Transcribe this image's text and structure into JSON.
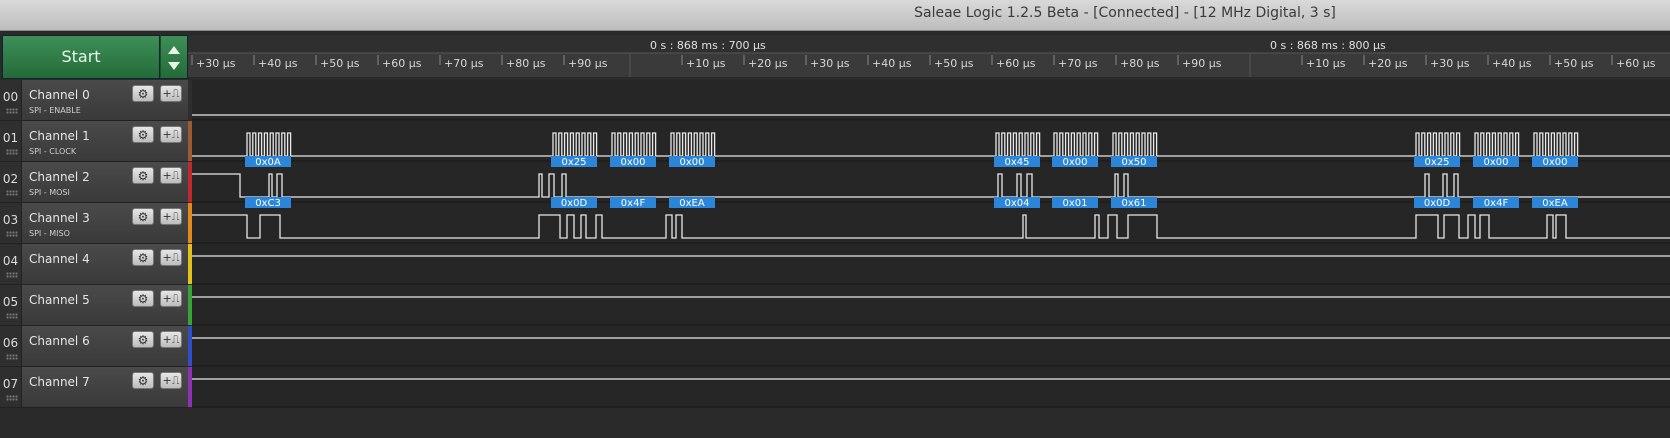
{
  "window": {
    "title": "Saleae Logic 1.2.5 Beta - [Connected] - [12 MHz Digital, 3 s]"
  },
  "start_button": {
    "label": "Start"
  },
  "timeline": {
    "groups": [
      {
        "label": "0 s : 868 ms : 700 µs"
      },
      {
        "label": "0 s : 868 ms : 800 µs"
      }
    ],
    "ticks": [
      "+30 µs",
      "+40 µs",
      "+50 µs",
      "+60 µs",
      "+70 µs",
      "+80 µs",
      "+90 µs",
      "+10 µs",
      "+20 µs",
      "+30 µs",
      "+40 µs",
      "+50 µs",
      "+60 µs",
      "+70 µs",
      "+80 µs",
      "+90 µs",
      "+10 µs",
      "+20 µs",
      "+30 µs",
      "+40 µs",
      "+50 µs",
      "+60 µs"
    ]
  },
  "channels": [
    {
      "num": "00",
      "name": "Channel 0",
      "sub": "SPI - ENABLE",
      "color": "#2e2e2e"
    },
    {
      "num": "01",
      "name": "Channel 1",
      "sub": "SPI - CLOCK",
      "color": "#9a5a32"
    },
    {
      "num": "02",
      "name": "Channel 2",
      "sub": "SPI - MOSI",
      "color": "#c0292e"
    },
    {
      "num": "03",
      "name": "Channel 3",
      "sub": "SPI - MISO",
      "color": "#e38a1b"
    },
    {
      "num": "04",
      "name": "Channel 4",
      "sub": "",
      "color": "#e2c21a"
    },
    {
      "num": "05",
      "name": "Channel 5",
      "sub": "",
      "color": "#38a338"
    },
    {
      "num": "06",
      "name": "Channel 6",
      "sub": "",
      "color": "#2f4fc7"
    },
    {
      "num": "07",
      "name": "Channel 7",
      "sub": "",
      "color": "#8e32b5"
    }
  ],
  "icons": {
    "gear": "gear-icon",
    "trigger": "trigger-icon"
  },
  "colors": {
    "label_bg": "#2b86d9",
    "trace": "#e8e8e8"
  },
  "decodes": {
    "mosi": [
      "0x0A",
      "0x25",
      "0x00",
      "0x00",
      "0x45",
      "0x00",
      "0x50",
      "0x25",
      "0x00",
      "0x00"
    ],
    "miso": [
      "0xC3",
      "0x0D",
      "0x4F",
      "0xEA",
      "0x04",
      "0x01",
      "0x61",
      "0x0D",
      "0x4F",
      "0xEA"
    ]
  }
}
